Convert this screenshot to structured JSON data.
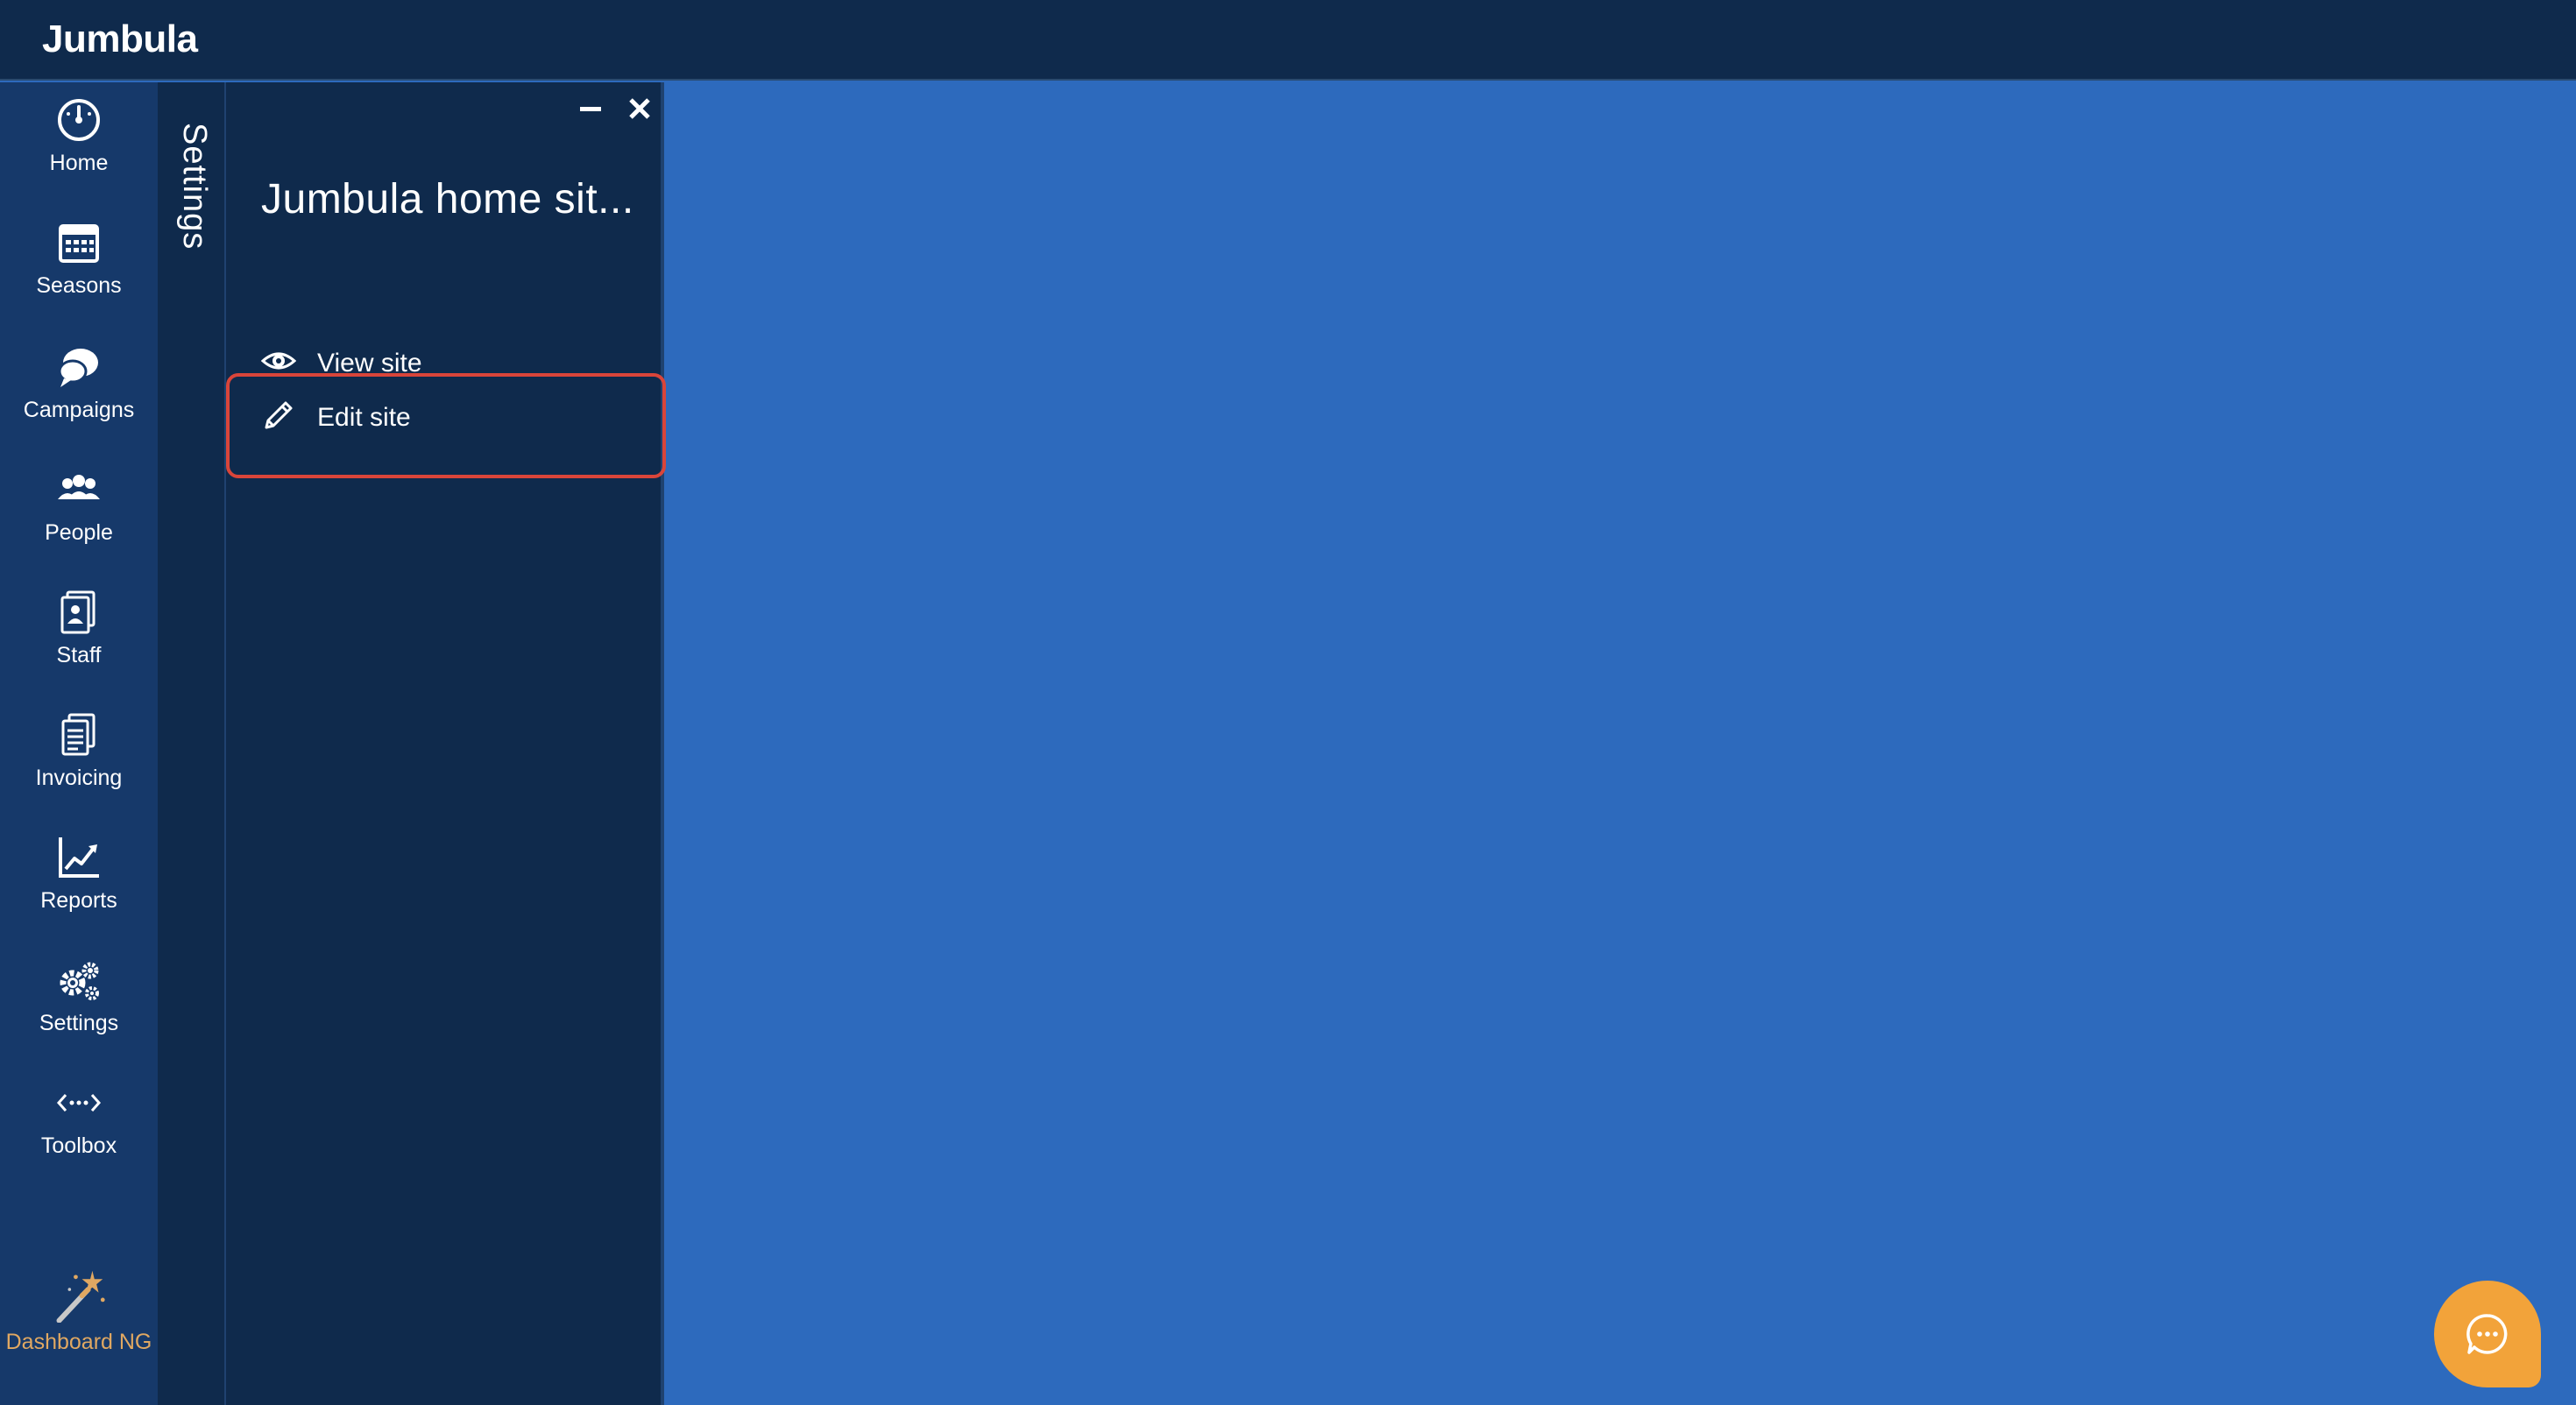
{
  "app": {
    "brand": "Jumbula"
  },
  "nav": {
    "items": [
      {
        "label": "Home",
        "icon": "dashboard-gauge-icon"
      },
      {
        "label": "Seasons",
        "icon": "calendar-icon"
      },
      {
        "label": "Campaigns",
        "icon": "chat-bubbles-icon"
      },
      {
        "label": "People",
        "icon": "people-icon"
      },
      {
        "label": "Staff",
        "icon": "staff-badge-icon"
      },
      {
        "label": "Invoicing",
        "icon": "documents-icon"
      },
      {
        "label": "Reports",
        "icon": "line-chart-icon"
      },
      {
        "label": "Settings",
        "icon": "gears-icon"
      },
      {
        "label": "Toolbox",
        "icon": "code-dots-icon"
      }
    ],
    "dashboard_ng": {
      "label": "Dashboard NG",
      "icon": "magic-wand-icon",
      "color": "#e0a862"
    }
  },
  "settings_strip": {
    "label": "Settings"
  },
  "panel": {
    "title": "Jumbula home sit...",
    "items": [
      {
        "label": "View site",
        "icon": "eye-icon"
      },
      {
        "label": "Edit site",
        "icon": "pencil-icon",
        "highlighted": true
      }
    ]
  },
  "colors": {
    "topbar": "#0f2a4c",
    "nav": "#16396a",
    "panel": "#0f2a4c",
    "content": "#2d6abd",
    "highlight": "#d9453a",
    "chat": "#f2a33a"
  },
  "chat": {
    "icon": "chat-dots-icon"
  }
}
